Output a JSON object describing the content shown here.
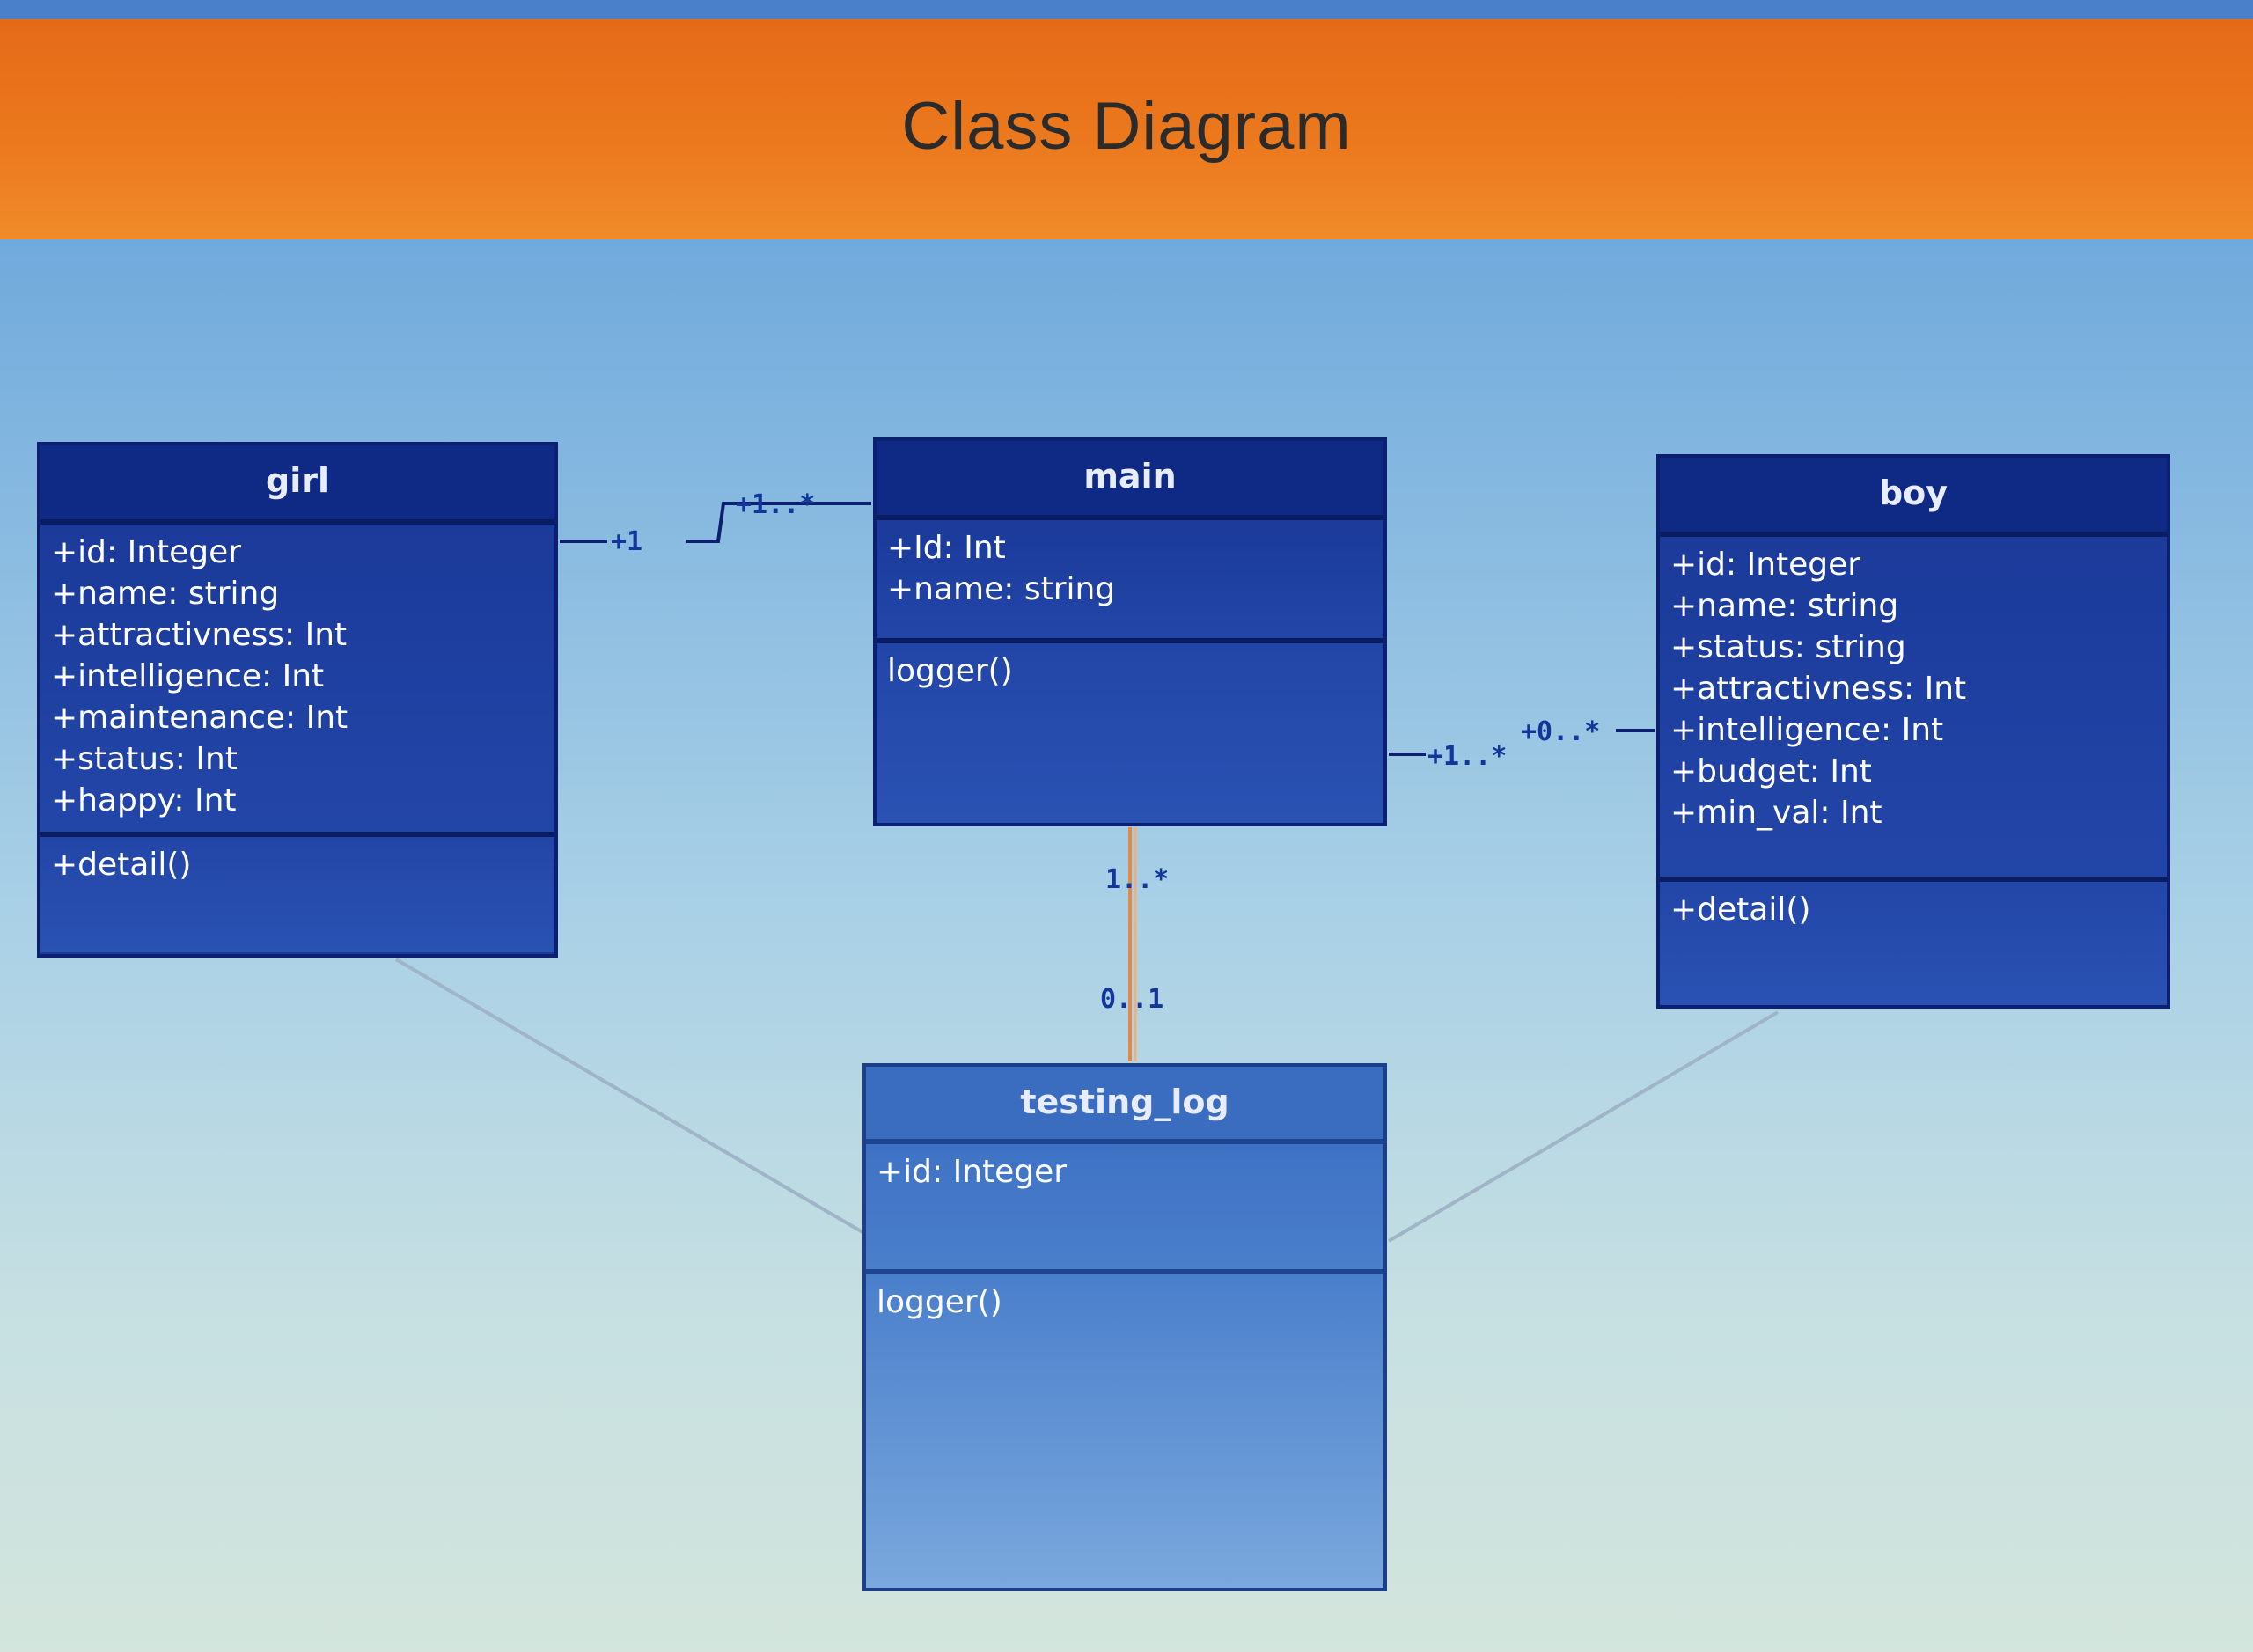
{
  "header": {
    "title": "Class Diagram"
  },
  "classes": {
    "girl": {
      "name": "girl",
      "attributes": [
        "+id: Integer",
        "+name: string",
        "+attractivness: Int",
        "+intelligence: Int",
        "+maintenance: Int",
        "+status: Int",
        "+happy: Int"
      ],
      "methods": [
        "+detail()"
      ]
    },
    "main": {
      "name": "main",
      "attributes": [
        "+Id: Int",
        "+name: string"
      ],
      "methods": [
        "logger()"
      ]
    },
    "boy": {
      "name": "boy",
      "attributes": [
        "+id: Integer",
        "+name: string",
        "+status: string",
        "+attractivness: Int",
        "+intelligence: Int",
        "+budget: Int",
        "+min_val: Int"
      ],
      "methods": [
        "+detail()"
      ]
    },
    "testing_log": {
      "name": "testing_log",
      "attributes": [
        "+id: Integer"
      ],
      "methods": [
        "logger()"
      ]
    }
  },
  "associations": {
    "girl_main": {
      "girl_end": "+1",
      "main_end": "+1..*"
    },
    "main_boy": {
      "main_end": "+1..*",
      "boy_end": "+0..*"
    },
    "main_testing": {
      "main_end": "1..*",
      "testing_end": "0..1"
    }
  },
  "colors": {
    "header": "#ec7a1e",
    "class_fill": "#1c3c9c",
    "class_border": "#0d1f70",
    "testing_fill": "#4a7fcb",
    "dependency_line": "#e0894a"
  }
}
